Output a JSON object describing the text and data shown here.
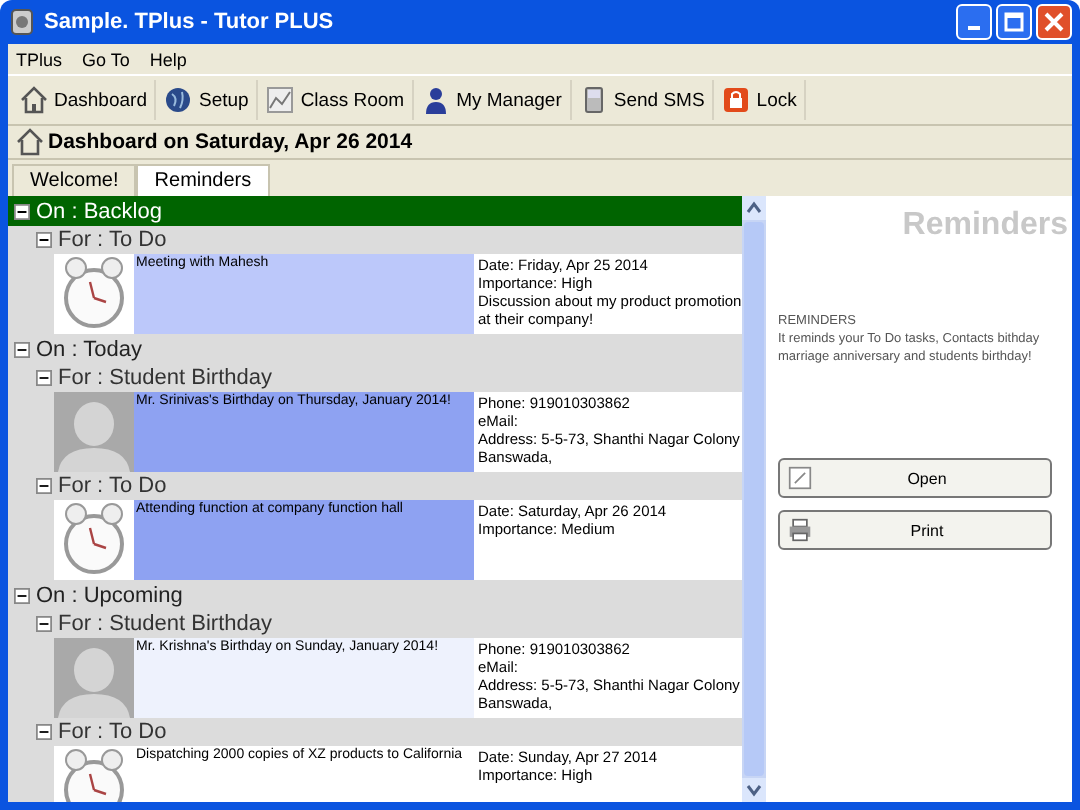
{
  "window": {
    "title": "Sample. TPlus - Tutor PLUS"
  },
  "menu": [
    "TPlus",
    "Go To",
    "Help"
  ],
  "toolbar": [
    "Dashboard",
    "Setup",
    "Class Room",
    "My Manager",
    "Send SMS",
    "Lock"
  ],
  "header": {
    "title": "Dashboard on Saturday, Apr 26 2014"
  },
  "tabs": [
    {
      "label": "Welcome!",
      "selected": false
    },
    {
      "label": "Reminders",
      "selected": true
    }
  ],
  "groups": [
    {
      "label": "On : Backlog",
      "selected": true,
      "expanded": true,
      "categories": [
        {
          "label": "For : To Do",
          "expanded": true,
          "items": [
            {
              "kind": "todo",
              "title": "Meeting with Mahesh",
              "color": "#bcc8fa",
              "details": [
                "Date: Friday, Apr 25 2014",
                "Importance: High",
                "Discussion about my product promotion",
                "at their company!"
              ]
            }
          ]
        }
      ]
    },
    {
      "label": "On : Today",
      "selected": false,
      "expanded": true,
      "categories": [
        {
          "label": "For : Student Birthday",
          "expanded": true,
          "items": [
            {
              "kind": "birthday",
              "title": "Mr. Srinivas's Birthday on Thursday, January 2014!",
              "color": "#8ea2f2",
              "details": [
                "Phone: 919010303862",
                "eMail:",
                "Address: 5-5-73, Shanthi Nagar Colony",
                "Banswada,"
              ]
            }
          ]
        },
        {
          "label": "For : To Do",
          "expanded": true,
          "items": [
            {
              "kind": "todo",
              "title": "Attending function at company function hall",
              "color": "#8ea2f2",
              "details": [
                "Date: Saturday, Apr 26 2014",
                "Importance: Medium"
              ]
            }
          ]
        }
      ]
    },
    {
      "label": "On : Upcoming",
      "selected": false,
      "expanded": true,
      "categories": [
        {
          "label": "For : Student Birthday",
          "expanded": true,
          "items": [
            {
              "kind": "birthday",
              "title": "Mr. Krishna's Birthday on Sunday, January 2014!",
              "color": "#eef2fd",
              "details": [
                "Phone: 919010303862",
                "eMail:",
                "Address: 5-5-73, Shanthi Nagar Colony",
                "Banswada,"
              ]
            }
          ]
        },
        {
          "label": "For : To Do",
          "expanded": true,
          "items": [
            {
              "kind": "todo",
              "title": "Dispatching 2000 copies of XZ products to California",
              "color": "#ffffff",
              "details": [
                "Date: Sunday, Apr 27 2014",
                "Importance: High"
              ]
            }
          ]
        }
      ]
    }
  ],
  "panel": {
    "title": "Reminders",
    "heading": "REMINDERS",
    "description": [
      "It reminds your To Do tasks, Contacts bithday",
      "marriage anniversary and students birthday!"
    ],
    "buttons": [
      "Open",
      "Print"
    ]
  }
}
